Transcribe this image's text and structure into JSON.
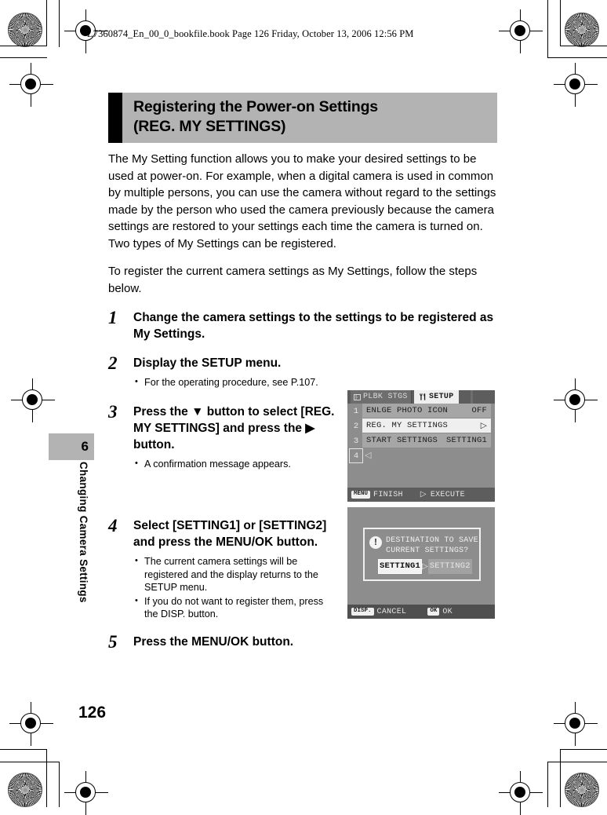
{
  "print_header": "L7360874_En_00_0_bookfile.book  Page 126  Friday, October 13, 2006  12:56 PM",
  "title": {
    "line1": "Registering the Power-on Settings",
    "line2": "(REG. MY SETTINGS)"
  },
  "paragraphs": {
    "intro": "The My Setting function allows you to make your desired settings to be used at power-on. For example, when a digital camera is used in common by multiple persons, you can use the camera without regard to the settings made by the person who used the camera previously because the camera settings are restored to your settings each time the camera is turned on.",
    "intro2": "Two types of My Settings can be registered.",
    "lead": "To register the current camera settings as My Settings, follow the steps below."
  },
  "steps": [
    {
      "num": "1",
      "text": "Change the camera settings to the settings to be registered as My Settings.",
      "bullets": []
    },
    {
      "num": "2",
      "text": "Display the SETUP menu.",
      "bullets": [
        "For the operating procedure, see P.107."
      ]
    },
    {
      "num": "3",
      "text": "Press the ▼ button to select [REG. MY SETTINGS] and press the ▶ button.",
      "bullets": [
        "A confirmation message appears."
      ]
    },
    {
      "num": "4",
      "text": "Select [SETTING1] or [SETTING2] and press the MENU/OK button.",
      "bullets": [
        "The current camera settings will be registered and the display returns to the SETUP menu.",
        "If you do not want to register them, press the DISP. button."
      ]
    },
    {
      "num": "5",
      "text": "Press the MENU/OK button.",
      "bullets": []
    }
  ],
  "chapter": {
    "number": "6",
    "label": "Changing Camera Settings"
  },
  "page_number": "126",
  "lcd_setup_menu": {
    "tab_inactive": "PLBK STGS",
    "tab_active": "SETUP",
    "rows": [
      {
        "index": "1",
        "label": "ENLGE PHOTO ICON",
        "value": "OFF",
        "selected": false
      },
      {
        "index": "2",
        "label": "REG. MY SETTINGS",
        "value": "▷",
        "selected": true
      },
      {
        "index": "3",
        "label": "START SETTINGS",
        "value": "SETTING1",
        "selected": false
      }
    ],
    "row4_index": "4",
    "row4_arrow": "◁",
    "footer": {
      "key_left": "MENU",
      "label_left": "FINISH",
      "key_right": "▷",
      "label_right": "EXECUTE"
    }
  },
  "lcd_confirm_dialog": {
    "warn_icon": "!",
    "message_line1": "DESTINATION TO SAVE",
    "message_line2": "CURRENT SETTINGS?",
    "choice_selected": "SETTING1",
    "choice_arrow": "▷",
    "choice_other": "SETTING2",
    "footer": {
      "key_left": "DISP.",
      "label_left": "CANCEL",
      "key_right": "OK",
      "label_right": "OK"
    }
  },
  "colors": {
    "title_bg": "#b3b3b3",
    "lcd_bg": "#8d8d8d",
    "lcd_row": "#a6a6a6",
    "lcd_selected": "#efefef",
    "lcd_bar": "#5d5d5d"
  }
}
